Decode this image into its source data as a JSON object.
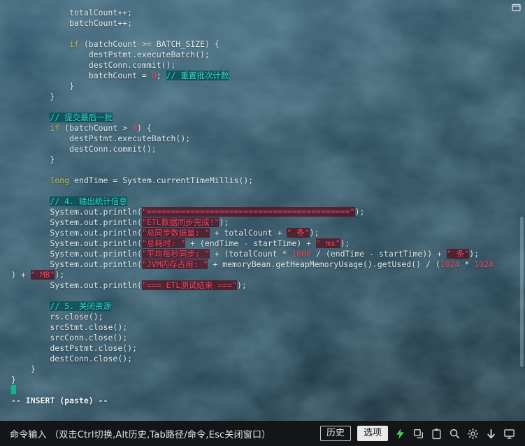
{
  "colors": {
    "background_base": "#234354",
    "keyword": "#c2b83c",
    "comment": "#38d6d2",
    "comment_bg": "#095256",
    "string": "#ec4a60",
    "string_bg": "#541022",
    "number": "#ec4a60",
    "plain_text": "#e3e8ea",
    "cursor": "#17b388",
    "toolbar_bg": "#141516",
    "accent_green": "#3fd34f"
  },
  "code": {
    "lines": [
      [
        [
          "p",
          "            totalCount++;"
        ]
      ],
      [
        [
          "p",
          "            batchCount++;"
        ]
      ],
      [],
      [
        [
          "p",
          "            "
        ],
        [
          "k",
          "if"
        ],
        [
          "p",
          " (batchCount >= BATCH_SIZE) {"
        ]
      ],
      [
        [
          "p",
          "                destPstmt.executeBatch();"
        ]
      ],
      [
        [
          "p",
          "                destConn.commit();"
        ]
      ],
      [
        [
          "p",
          "                batchCount = "
        ],
        [
          "n",
          "0"
        ],
        [
          "p",
          "; "
        ],
        [
          "c",
          "// 重置批次计数"
        ]
      ],
      [
        [
          "p",
          "            }"
        ]
      ],
      [
        [
          "p",
          "        }"
        ]
      ],
      [],
      [
        [
          "p",
          "        "
        ],
        [
          "c",
          "// 提交最后一批"
        ]
      ],
      [
        [
          "p",
          "        "
        ],
        [
          "k",
          "if"
        ],
        [
          "p",
          " (batchCount > "
        ],
        [
          "n",
          "0"
        ],
        [
          "p",
          ") {"
        ]
      ],
      [
        [
          "p",
          "            destPstmt.executeBatch();"
        ]
      ],
      [
        [
          "p",
          "            destConn.commit();"
        ]
      ],
      [
        [
          "p",
          "        }"
        ]
      ],
      [],
      [
        [
          "p",
          "        "
        ],
        [
          "k",
          "long"
        ],
        [
          "p",
          " endTime = System.currentTimeMillis();"
        ]
      ],
      [],
      [
        [
          "p",
          "        "
        ],
        [
          "c",
          "// 4. 输出统计信息"
        ]
      ],
      [
        [
          "p",
          "        System.out.println("
        ],
        [
          "s",
          "\"==========================================\""
        ],
        [
          "p",
          ");"
        ]
      ],
      [
        [
          "p",
          "        System.out.println("
        ],
        [
          "s",
          "\"ETL数据同步完成!\""
        ],
        [
          "p",
          ");"
        ]
      ],
      [
        [
          "p",
          "        System.out.println("
        ],
        [
          "s",
          "\"总同步数据量: \""
        ],
        [
          "p",
          " + totalCount + "
        ],
        [
          "s",
          "\" 条\""
        ],
        [
          "p",
          ");"
        ]
      ],
      [
        [
          "p",
          "        System.out.println("
        ],
        [
          "s",
          "\"总耗时: \""
        ],
        [
          "p",
          " + (endTime - startTime) + "
        ],
        [
          "s",
          "\" ms\""
        ],
        [
          "p",
          ");"
        ]
      ],
      [
        [
          "p",
          "        System.out.println("
        ],
        [
          "s",
          "\"平均每秒同步: \""
        ],
        [
          "p",
          " + (totalCount * "
        ],
        [
          "n",
          "1000"
        ],
        [
          "p",
          " / (endTime - startTime)) + "
        ],
        [
          "s",
          "\" 条\""
        ],
        [
          "p",
          ");"
        ]
      ],
      [
        [
          "p",
          "        System.out.println("
        ],
        [
          "s",
          "\"JVM内存占用: \""
        ],
        [
          "p",
          " + memoryBean.getHeapMemoryUsage().getUsed() / ("
        ],
        [
          "n",
          "1024"
        ],
        [
          "p",
          " * "
        ],
        [
          "n",
          "1024"
        ]
      ],
      [
        [
          "p",
          ") + "
        ],
        [
          "s",
          "\" MB\""
        ],
        [
          "p",
          ");"
        ]
      ],
      [
        [
          "p",
          "        System.out.println("
        ],
        [
          "s",
          "\"=== ETL测试结束 ===\""
        ],
        [
          "p",
          ");"
        ]
      ],
      [],
      [
        [
          "p",
          "        "
        ],
        [
          "c",
          "// 5. 关闭资源"
        ]
      ],
      [
        [
          "p",
          "        rs.close();"
        ]
      ],
      [
        [
          "p",
          "        srcStmt.close();"
        ]
      ],
      [
        [
          "p",
          "        srcConn.close();"
        ]
      ],
      [
        [
          "p",
          "        destPstmt.close();"
        ]
      ],
      [
        [
          "p",
          "        destConn.close();"
        ]
      ],
      [
        [
          "p",
          "    }"
        ]
      ],
      [
        [
          "p",
          "}"
        ]
      ]
    ]
  },
  "status_line": "-- INSERT (paste) --",
  "toolbar": {
    "hint": "命令输入 （双击Ctrl切换,Alt历史,Tab路径/命令,Esc关闭窗口）",
    "history_label": "历史",
    "options_label": "选项",
    "icons": [
      "lightning-icon",
      "copy-icon",
      "paste-icon",
      "search-icon",
      "gear-icon",
      "down-arrow-icon",
      "monitor-icon"
    ]
  }
}
